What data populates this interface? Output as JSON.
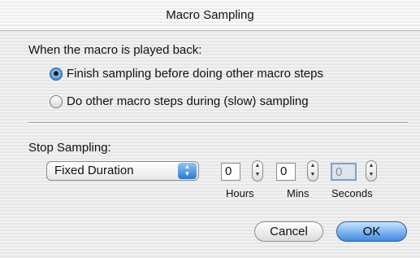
{
  "window": {
    "title": "Macro Sampling"
  },
  "playback": {
    "heading": "When the macro is played back:",
    "options": [
      {
        "label": "Finish sampling before doing other macro steps",
        "selected": true
      },
      {
        "label": "Do other macro steps during (slow) sampling",
        "selected": false
      }
    ]
  },
  "stop": {
    "heading": "Stop Sampling:",
    "mode": "Fixed Duration",
    "hours": {
      "value": "0",
      "label": "Hours"
    },
    "mins": {
      "value": "0",
      "label": "Mins"
    },
    "seconds": {
      "value": "0",
      "label": "Seconds"
    }
  },
  "buttons": {
    "cancel": "Cancel",
    "ok": "OK"
  }
}
